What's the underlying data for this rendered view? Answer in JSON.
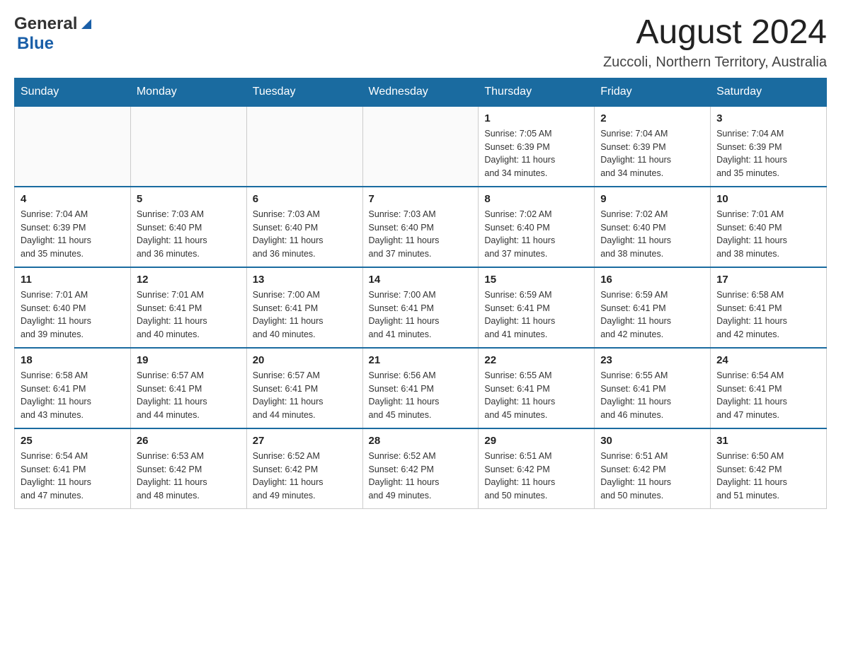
{
  "header": {
    "logo_general": "General",
    "logo_blue": "Blue",
    "month_title": "August 2024",
    "location": "Zuccoli, Northern Territory, Australia"
  },
  "days_of_week": [
    "Sunday",
    "Monday",
    "Tuesday",
    "Wednesday",
    "Thursday",
    "Friday",
    "Saturday"
  ],
  "weeks": [
    {
      "days": [
        {
          "number": "",
          "info": ""
        },
        {
          "number": "",
          "info": ""
        },
        {
          "number": "",
          "info": ""
        },
        {
          "number": "",
          "info": ""
        },
        {
          "number": "1",
          "info": "Sunrise: 7:05 AM\nSunset: 6:39 PM\nDaylight: 11 hours\nand 34 minutes."
        },
        {
          "number": "2",
          "info": "Sunrise: 7:04 AM\nSunset: 6:39 PM\nDaylight: 11 hours\nand 34 minutes."
        },
        {
          "number": "3",
          "info": "Sunrise: 7:04 AM\nSunset: 6:39 PM\nDaylight: 11 hours\nand 35 minutes."
        }
      ]
    },
    {
      "days": [
        {
          "number": "4",
          "info": "Sunrise: 7:04 AM\nSunset: 6:39 PM\nDaylight: 11 hours\nand 35 minutes."
        },
        {
          "number": "5",
          "info": "Sunrise: 7:03 AM\nSunset: 6:40 PM\nDaylight: 11 hours\nand 36 minutes."
        },
        {
          "number": "6",
          "info": "Sunrise: 7:03 AM\nSunset: 6:40 PM\nDaylight: 11 hours\nand 36 minutes."
        },
        {
          "number": "7",
          "info": "Sunrise: 7:03 AM\nSunset: 6:40 PM\nDaylight: 11 hours\nand 37 minutes."
        },
        {
          "number": "8",
          "info": "Sunrise: 7:02 AM\nSunset: 6:40 PM\nDaylight: 11 hours\nand 37 minutes."
        },
        {
          "number": "9",
          "info": "Sunrise: 7:02 AM\nSunset: 6:40 PM\nDaylight: 11 hours\nand 38 minutes."
        },
        {
          "number": "10",
          "info": "Sunrise: 7:01 AM\nSunset: 6:40 PM\nDaylight: 11 hours\nand 38 minutes."
        }
      ]
    },
    {
      "days": [
        {
          "number": "11",
          "info": "Sunrise: 7:01 AM\nSunset: 6:40 PM\nDaylight: 11 hours\nand 39 minutes."
        },
        {
          "number": "12",
          "info": "Sunrise: 7:01 AM\nSunset: 6:41 PM\nDaylight: 11 hours\nand 40 minutes."
        },
        {
          "number": "13",
          "info": "Sunrise: 7:00 AM\nSunset: 6:41 PM\nDaylight: 11 hours\nand 40 minutes."
        },
        {
          "number": "14",
          "info": "Sunrise: 7:00 AM\nSunset: 6:41 PM\nDaylight: 11 hours\nand 41 minutes."
        },
        {
          "number": "15",
          "info": "Sunrise: 6:59 AM\nSunset: 6:41 PM\nDaylight: 11 hours\nand 41 minutes."
        },
        {
          "number": "16",
          "info": "Sunrise: 6:59 AM\nSunset: 6:41 PM\nDaylight: 11 hours\nand 42 minutes."
        },
        {
          "number": "17",
          "info": "Sunrise: 6:58 AM\nSunset: 6:41 PM\nDaylight: 11 hours\nand 42 minutes."
        }
      ]
    },
    {
      "days": [
        {
          "number": "18",
          "info": "Sunrise: 6:58 AM\nSunset: 6:41 PM\nDaylight: 11 hours\nand 43 minutes."
        },
        {
          "number": "19",
          "info": "Sunrise: 6:57 AM\nSunset: 6:41 PM\nDaylight: 11 hours\nand 44 minutes."
        },
        {
          "number": "20",
          "info": "Sunrise: 6:57 AM\nSunset: 6:41 PM\nDaylight: 11 hours\nand 44 minutes."
        },
        {
          "number": "21",
          "info": "Sunrise: 6:56 AM\nSunset: 6:41 PM\nDaylight: 11 hours\nand 45 minutes."
        },
        {
          "number": "22",
          "info": "Sunrise: 6:55 AM\nSunset: 6:41 PM\nDaylight: 11 hours\nand 45 minutes."
        },
        {
          "number": "23",
          "info": "Sunrise: 6:55 AM\nSunset: 6:41 PM\nDaylight: 11 hours\nand 46 minutes."
        },
        {
          "number": "24",
          "info": "Sunrise: 6:54 AM\nSunset: 6:41 PM\nDaylight: 11 hours\nand 47 minutes."
        }
      ]
    },
    {
      "days": [
        {
          "number": "25",
          "info": "Sunrise: 6:54 AM\nSunset: 6:41 PM\nDaylight: 11 hours\nand 47 minutes."
        },
        {
          "number": "26",
          "info": "Sunrise: 6:53 AM\nSunset: 6:42 PM\nDaylight: 11 hours\nand 48 minutes."
        },
        {
          "number": "27",
          "info": "Sunrise: 6:52 AM\nSunset: 6:42 PM\nDaylight: 11 hours\nand 49 minutes."
        },
        {
          "number": "28",
          "info": "Sunrise: 6:52 AM\nSunset: 6:42 PM\nDaylight: 11 hours\nand 49 minutes."
        },
        {
          "number": "29",
          "info": "Sunrise: 6:51 AM\nSunset: 6:42 PM\nDaylight: 11 hours\nand 50 minutes."
        },
        {
          "number": "30",
          "info": "Sunrise: 6:51 AM\nSunset: 6:42 PM\nDaylight: 11 hours\nand 50 minutes."
        },
        {
          "number": "31",
          "info": "Sunrise: 6:50 AM\nSunset: 6:42 PM\nDaylight: 11 hours\nand 51 minutes."
        }
      ]
    }
  ]
}
